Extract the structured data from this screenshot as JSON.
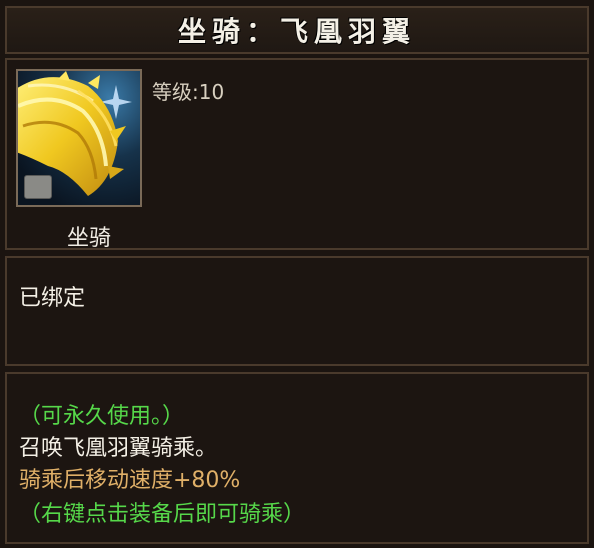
{
  "title": "坐骑：飞凰羽翼",
  "item": {
    "icon": "phoenix-wing-icon",
    "level_text": "等级:10",
    "type_label": "坐骑",
    "bound_text": "已绑定"
  },
  "description": {
    "line1": "（可永久使用。）",
    "line2": "召唤飞凰羽翼骑乘。",
    "line3": "骑乘后移动速度+80%",
    "line4": "（右键点击装备后即可骑乘）"
  },
  "colors": {
    "green": "#56d84a",
    "white": "#f4f0e6",
    "orange": "#e0b068",
    "border": "#4a3a2c",
    "background": "#1c1511"
  }
}
